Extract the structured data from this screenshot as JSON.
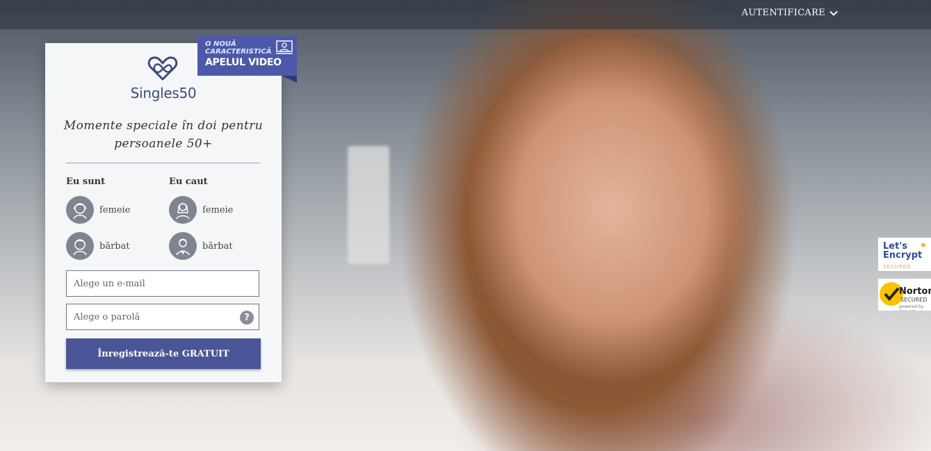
{
  "header": {
    "login_label": "AUTENTIFICARE"
  },
  "brand": {
    "name": "Singles50",
    "accent_color": "#4a5597"
  },
  "ribbon": {
    "line1": "O NOUĂ",
    "line2": "CARACTERISTICĂ",
    "title": "APELUL VIDEO"
  },
  "tagline": "Momente speciale în doi pentru persoanele 50+",
  "form": {
    "i_am_label": "Eu sunt",
    "seeking_label": "Eu caut",
    "options": {
      "female": "femeie",
      "male": "bărbat"
    },
    "email_placeholder": "Alege un e-mail",
    "password_placeholder": "Alege o parolă",
    "help_symbol": "?",
    "submit_label": "Înregistrează-te GRATUIT"
  },
  "trust_badges": {
    "letsencrypt": {
      "line1": "Let's",
      "line2": "Encrypt",
      "line3": "SECURED"
    },
    "norton": {
      "name": "Norton",
      "line2": "SECURED",
      "line3": "powered by digicert"
    }
  },
  "icons": [
    "heart-infinity-icon",
    "video-call-icon",
    "chevron-down-icon",
    "female-avatar-icon",
    "male-avatar-icon",
    "help-icon",
    "checkmark-icon"
  ]
}
